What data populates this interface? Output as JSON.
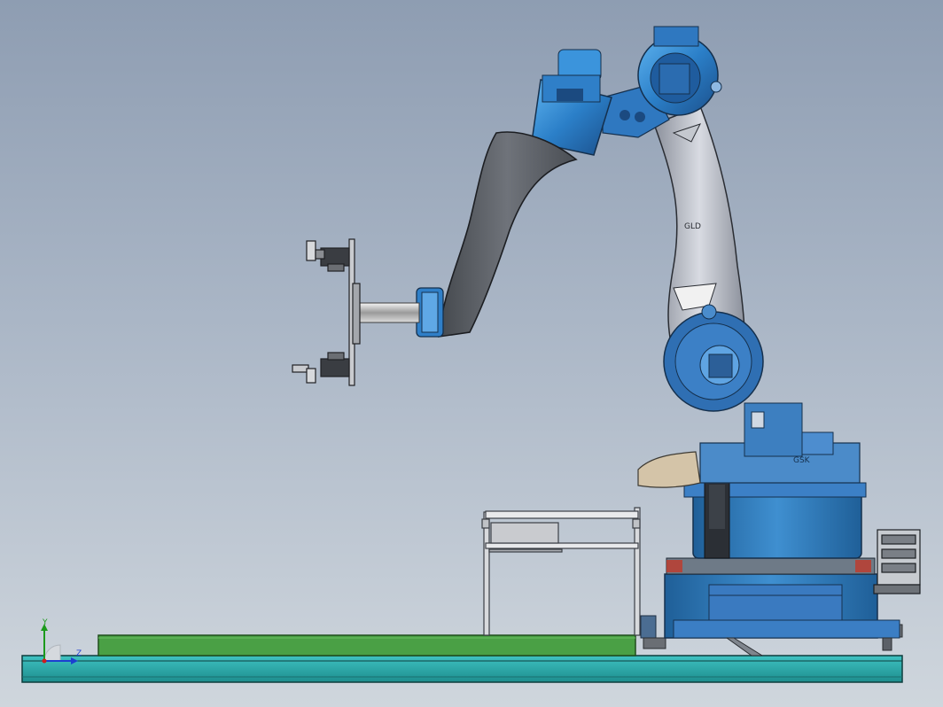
{
  "model_view": {
    "triad": {
      "y_label": "Y",
      "z_label": "Z",
      "y_color": "#1c9a1c",
      "z_color": "#1c3fd0"
    },
    "colors": {
      "background_top": "#8e9db2",
      "background_bottom": "#cfd6dd",
      "robot_blue": "#2b7fc8",
      "robot_dark_blue": "#2f5f9a",
      "arm_grey": "#6a6e74",
      "floor_teal": "#2fb3b3",
      "conveyor_green": "#4aa045"
    }
  }
}
